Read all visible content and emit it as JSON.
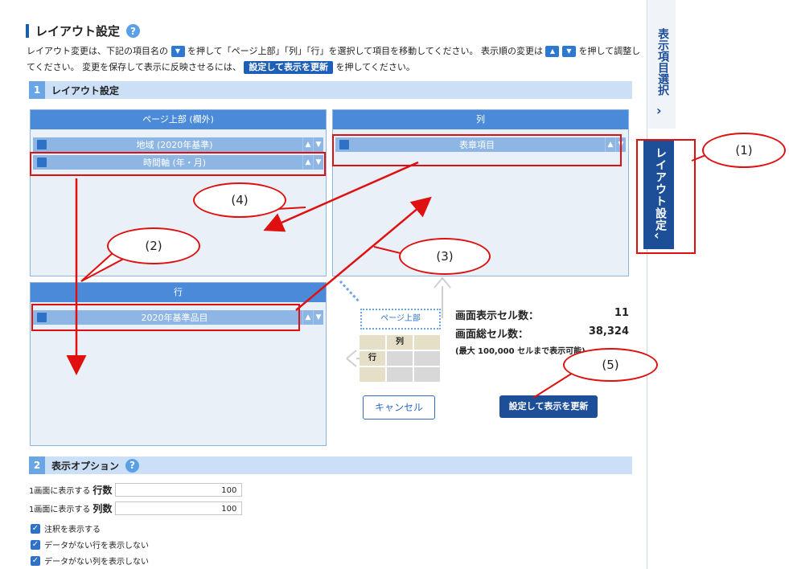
{
  "title": "レイアウト設定",
  "desc": {
    "p1": "レイアウト変更は、下記の項目名の",
    "p2": "を押して「ページ上部」「列」「行」を選択して項目を移動してください。 表示順の変更は",
    "p3": "を押して調整してください。 変更を保存して表示に反映させるには、",
    "p4": "設定して表示を更新",
    "p5": "を押してください。"
  },
  "section1": {
    "num": "1",
    "label": "レイアウト設定"
  },
  "section2": {
    "num": "2",
    "label": "表示オプション"
  },
  "panels": {
    "page_top": {
      "header": "ページ上部 (欄外)",
      "items": [
        "地域 (2020年基準)",
        "時間軸 (年・月)"
      ]
    },
    "column": {
      "header": "列",
      "items": [
        "表章項目"
      ]
    },
    "row": {
      "header": "行",
      "items": [
        "2020年基準品目"
      ]
    }
  },
  "diagram": {
    "page_top": "ページ上部",
    "col": "列",
    "row": "行"
  },
  "stats": {
    "display_label": "画面表示セル数：",
    "display_value": "11",
    "total_label": "画面総セル数：",
    "total_value": "38,324",
    "note": "(最大 100,000 セルまで表示可能)"
  },
  "buttons": {
    "cancel": "キャンセル",
    "update": "設定して表示を更新"
  },
  "options": {
    "rows_prefix": "1画面に表示する",
    "rows_bold": "行数",
    "rows_value": "100",
    "cols_prefix": "1画面に表示する",
    "cols_bold": "列数",
    "cols_value": "100",
    "checks": [
      "注釈を表示する",
      "データがない行を表示しない",
      "データがない列を表示しない"
    ]
  },
  "side": {
    "item_select": "表示項目選択",
    "layout": "レイアウト設定"
  },
  "callouts": [
    "(1)",
    "(2)",
    "(3)",
    "(4)",
    "(5)"
  ],
  "help_glyph": "?",
  "colors": {
    "accent": "#1d4e98",
    "panel_header": "#4a8ad8",
    "annotation": "#e01010"
  }
}
